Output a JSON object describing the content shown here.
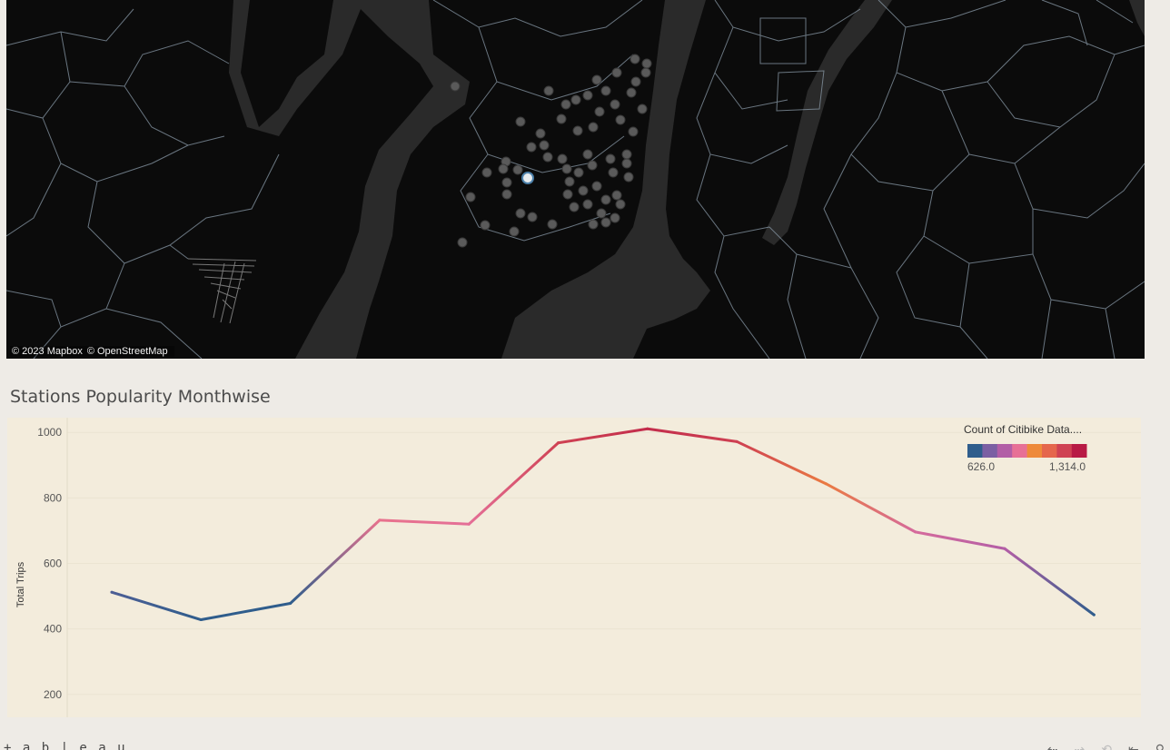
{
  "map": {
    "attribution": [
      "© 2023 Mapbox",
      "© OpenStreetMap"
    ]
  },
  "chart": {
    "title": "Stations Popularity Monthwise"
  },
  "chart_data": {
    "type": "line",
    "ylabel": "Total Trips",
    "ylim": [
      130,
      1045
    ],
    "yticks": [
      200,
      400,
      600,
      800,
      1000
    ],
    "ytick_labels": [
      "200",
      "400",
      "600",
      "800",
      "1000"
    ],
    "x": [
      1,
      2,
      3,
      4,
      5,
      6,
      7,
      8,
      9,
      10,
      11,
      12
    ],
    "values": [
      512,
      428,
      478,
      732,
      720,
      968,
      1011,
      972,
      843,
      696,
      645,
      443
    ],
    "grid": true,
    "legend": {
      "title": "Count of Citibike Data....",
      "min_label": "626.0",
      "max_label": "1,314.0",
      "min": 626,
      "max": 1314,
      "colors": [
        "#2f5d8c",
        "#7b5fa3",
        "#b25ea6",
        "#e77096",
        "#ee8a3a",
        "#e5664c",
        "#cf4253",
        "#b81a45"
      ]
    }
  },
  "footer": {
    "logo": "+ a b | e a u",
    "controls": [
      "undo-icon",
      "redo-icon",
      "revert-icon",
      "reset-icon",
      "share-icon"
    ]
  }
}
